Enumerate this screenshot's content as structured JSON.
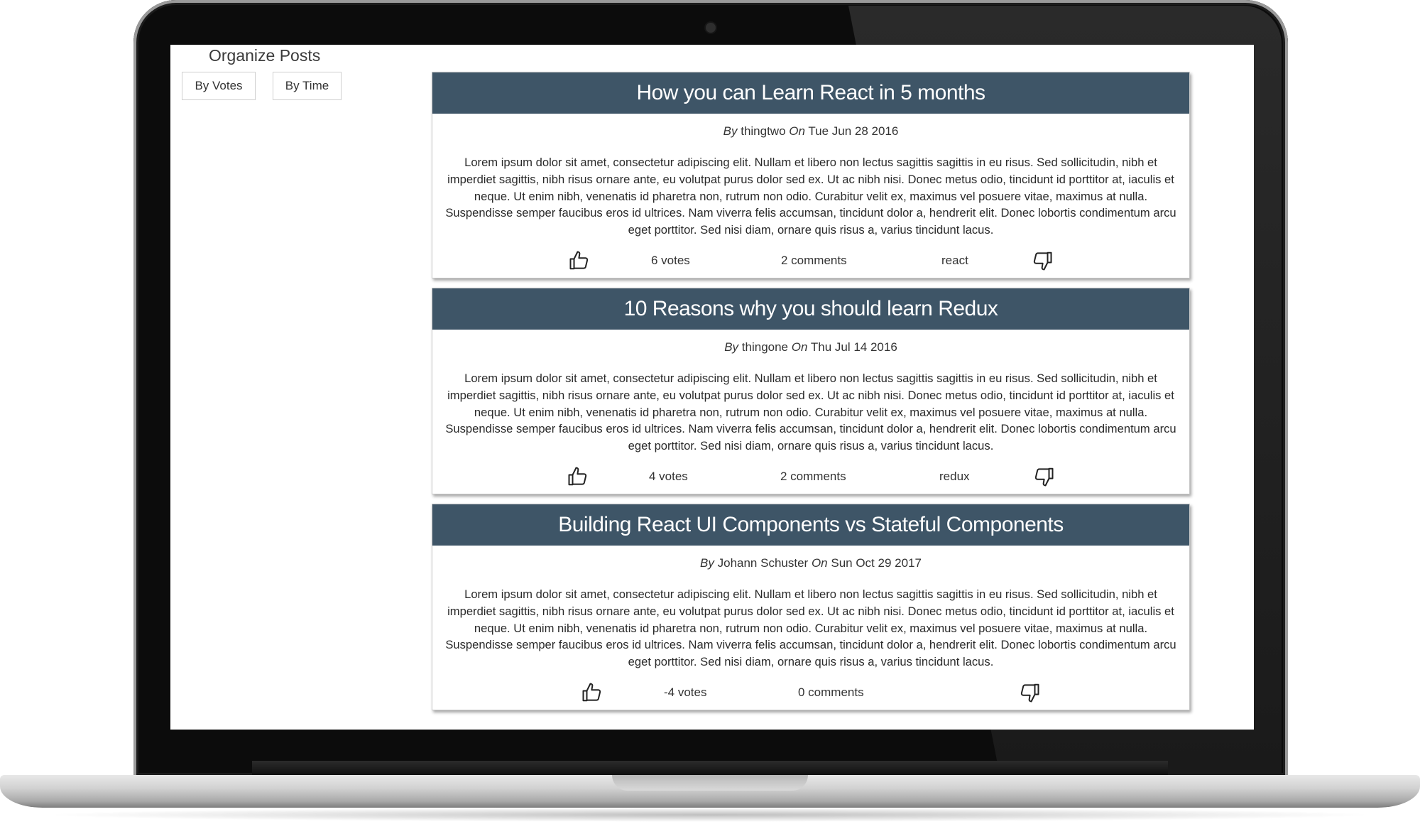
{
  "sidebar": {
    "title": "Organize Posts",
    "sort_buttons": [
      {
        "label": "By Votes"
      },
      {
        "label": "By Time"
      }
    ]
  },
  "posts": [
    {
      "title": "How you can Learn React in 5 months",
      "by_label": "By",
      "author": "thingtwo",
      "on_label": "On",
      "date": "Tue Jun 28 2016",
      "body": "Lorem ipsum dolor sit amet, consectetur adipiscing elit. Nullam et libero non lectus sagittis sagittis in eu risus. Sed sollicitudin, nibh et imperdiet sagittis, nibh risus ornare ante, eu volutpat purus dolor sed ex. Ut ac nibh nisi. Donec metus odio, tincidunt id porttitor at, iaculis et neque. Ut enim nibh, venenatis id pharetra non, rutrum non odio. Curabitur velit ex, maximus vel posuere vitae, maximus at nulla. Suspendisse semper faucibus eros id ultrices. Nam viverra felis accumsan, tincidunt dolor a, hendrerit elit. Donec lobortis condimentum arcu eget porttitor. Sed nisi diam, ornare quis risus a, varius tincidunt lacus.",
      "votes": "6 votes",
      "comments": "2 comments",
      "category": "react"
    },
    {
      "title": "10 Reasons why you should learn Redux",
      "by_label": "By",
      "author": "thingone",
      "on_label": "On",
      "date": "Thu Jul 14 2016",
      "body": "Lorem ipsum dolor sit amet, consectetur adipiscing elit. Nullam et libero non lectus sagittis sagittis in eu risus. Sed sollicitudin, nibh et imperdiet sagittis, nibh risus ornare ante, eu volutpat purus dolor sed ex. Ut ac nibh nisi. Donec metus odio, tincidunt id porttitor at, iaculis et neque. Ut enim nibh, venenatis id pharetra non, rutrum non odio. Curabitur velit ex, maximus vel posuere vitae, maximus at nulla. Suspendisse semper faucibus eros id ultrices. Nam viverra felis accumsan, tincidunt dolor a, hendrerit elit. Donec lobortis condimentum arcu eget porttitor. Sed nisi diam, ornare quis risus a, varius tincidunt lacus.",
      "votes": "4 votes",
      "comments": "2 comments",
      "category": "redux"
    },
    {
      "title": "Building React UI Components vs Stateful Components",
      "by_label": "By",
      "author": "Johann Schuster",
      "on_label": "On",
      "date": "Sun Oct 29 2017",
      "body": "Lorem ipsum dolor sit amet, consectetur adipiscing elit. Nullam et libero non lectus sagittis sagittis in eu risus. Sed sollicitudin, nibh et imperdiet sagittis, nibh risus ornare ante, eu volutpat purus dolor sed ex. Ut ac nibh nisi. Donec metus odio, tincidunt id porttitor at, iaculis et neque. Ut enim nibh, venenatis id pharetra non, rutrum non odio. Curabitur velit ex, maximus vel posuere vitae, maximus at nulla. Suspendisse semper faucibus eros id ultrices. Nam viverra felis accumsan, tincidunt dolor a, hendrerit elit. Donec lobortis condimentum arcu eget porttitor. Sed nisi diam, ornare quis risus a, varius tincidunt lacus.",
      "votes": "-4 votes",
      "comments": "0 comments",
      "category": ""
    }
  ],
  "icons": {
    "upvote": "thumbs-up-icon",
    "downvote": "thumbs-down-icon"
  },
  "colors": {
    "post_header_bg": "#3e5567",
    "post_header_text": "#ffffff"
  }
}
